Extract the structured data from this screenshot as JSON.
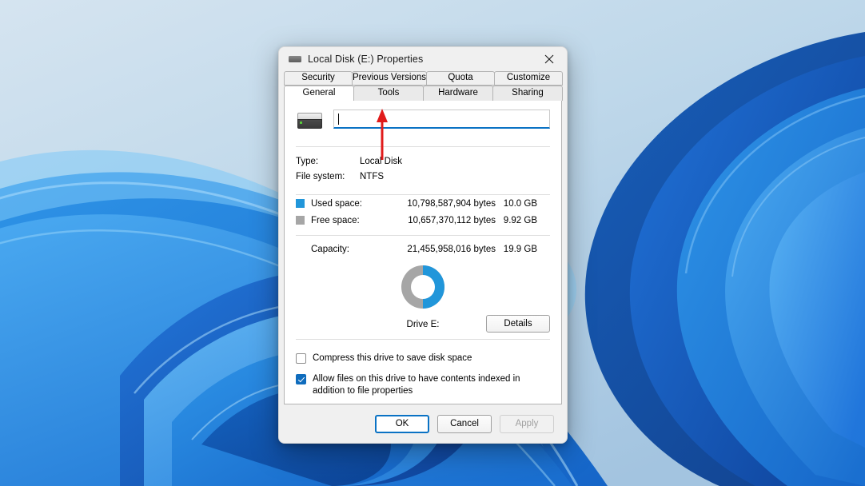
{
  "window": {
    "title": "Local Disk (E:) Properties",
    "icon": "hard-drive-icon",
    "close_label": "✕"
  },
  "tabs": {
    "top_row": [
      {
        "label": "Security",
        "active": false
      },
      {
        "label": "Previous Versions",
        "active": false
      },
      {
        "label": "Quota",
        "active": false
      },
      {
        "label": "Customize",
        "active": false
      }
    ],
    "bottom_row": [
      {
        "label": "General",
        "active": true
      },
      {
        "label": "Tools",
        "active": false
      },
      {
        "label": "Hardware",
        "active": false
      },
      {
        "label": "Sharing",
        "active": false
      }
    ]
  },
  "general": {
    "volume_label": {
      "value": "",
      "placeholder": "",
      "focused": true
    },
    "info": [
      {
        "key": "Type:",
        "value": "Local Disk"
      },
      {
        "key": "File system:",
        "value": "NTFS"
      }
    ],
    "space": {
      "used": {
        "label": "Used space:",
        "bytes": "10,798,587,904 bytes",
        "gb": "10.0 GB",
        "color": "#2196da"
      },
      "free": {
        "label": "Free space:",
        "bytes": "10,657,370,112 bytes",
        "gb": "9.92 GB",
        "color": "#a6a6a6"
      },
      "capacity": {
        "label": "Capacity:",
        "bytes": "21,455,958,016 bytes",
        "gb": "19.9 GB"
      }
    },
    "drive_caption": "Drive E:",
    "details_button": "Details",
    "checkboxes": [
      {
        "label": "Compress this drive to save disk space",
        "checked": false
      },
      {
        "label": "Allow files on this drive to have contents indexed in addition to file properties",
        "checked": true
      }
    ]
  },
  "footer": {
    "ok": "OK",
    "cancel": "Cancel",
    "apply": "Apply",
    "apply_enabled": false
  },
  "annotation": {
    "type": "arrow",
    "color": "#e01b1b",
    "points_to": "volume-label-input"
  },
  "chart_data": {
    "type": "pie",
    "title": "Drive E: disk usage",
    "labels": [
      "Used space",
      "Free space"
    ],
    "values": [
      10798587904,
      10657370112
    ],
    "percentages": [
      50.3,
      49.7
    ],
    "display_values": [
      "10.0 GB",
      "9.92 GB"
    ],
    "colors": [
      "#2196da",
      "#a6a6a6"
    ],
    "total": 21455958016,
    "total_display": "19.9 GB",
    "style": "donut",
    "legend": "left-list",
    "start_angle": 0
  }
}
